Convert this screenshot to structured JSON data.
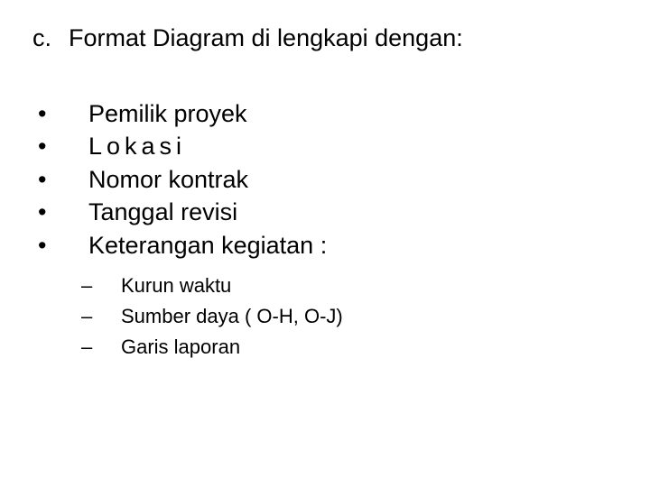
{
  "heading": {
    "marker": "c.",
    "text": "Format Diagram di lengkapi dengan:"
  },
  "bullets": [
    {
      "dot": "•",
      "text": "Pemilik proyek",
      "spaced": false
    },
    {
      "dot": "•",
      "text": "Lokasi",
      "spaced": true
    },
    {
      "dot": "•",
      "text": "Nomor kontrak",
      "spaced": false
    },
    {
      "dot": "•",
      "text": "Tanggal revisi",
      "spaced": false
    },
    {
      "dot": "•",
      "text": "Keterangan kegiatan :",
      "spaced": false
    }
  ],
  "subbullets": [
    {
      "dash": "–",
      "text": "Kurun waktu"
    },
    {
      "dash": "–",
      "text": "Sumber daya ( O-H,  O-J)"
    },
    {
      "dash": "–",
      "text": "Garis laporan"
    }
  ]
}
